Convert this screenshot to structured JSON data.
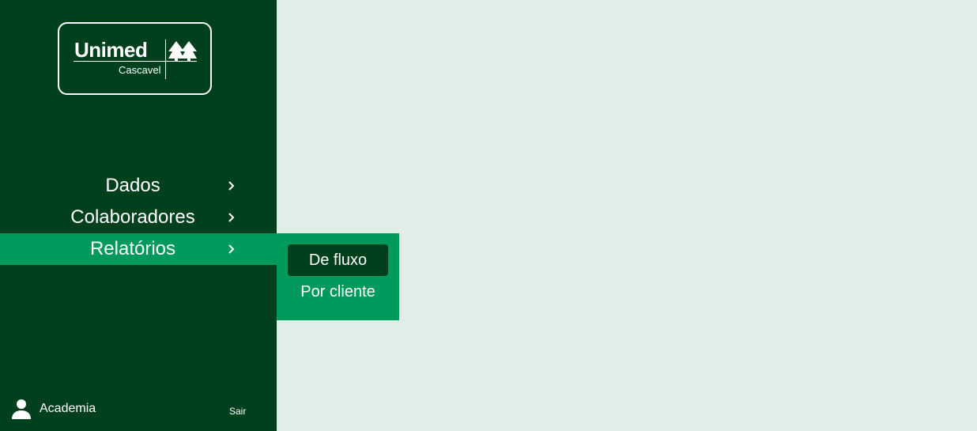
{
  "brand": {
    "name": "Unimed",
    "unit": "Cascavel"
  },
  "menu": {
    "items": [
      {
        "label": "Dados",
        "active": false
      },
      {
        "label": "Colaboradores",
        "active": false
      },
      {
        "label": "Relatórios",
        "active": true
      }
    ],
    "submenu": [
      {
        "label": "De fluxo",
        "selected": true
      },
      {
        "label": "Por cliente",
        "selected": false
      }
    ]
  },
  "user": {
    "name": "Academia",
    "logout_label": "Sair"
  },
  "colors": {
    "sidebar": "#00401c",
    "accent": "#009a5d",
    "content_bg": "#dfefe7"
  }
}
